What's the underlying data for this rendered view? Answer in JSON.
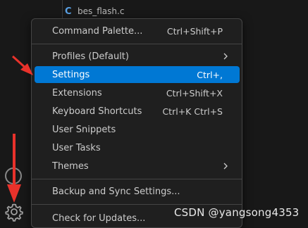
{
  "explorer": {
    "file_icon": "C",
    "file_name": "bes_flash.c"
  },
  "activity_bar": {
    "account_icon": "account-icon",
    "manage_icon": "gear-icon"
  },
  "menu": {
    "items": [
      {
        "label": "Command Palette...",
        "shortcut": "Ctrl+Shift+P"
      },
      {
        "label": "Profiles (Default)",
        "submenu": true
      },
      {
        "label": "Settings",
        "shortcut": "Ctrl+,",
        "active": true
      },
      {
        "label": "Extensions",
        "shortcut": "Ctrl+Shift+X"
      },
      {
        "label": "Keyboard Shortcuts",
        "shortcut": "Ctrl+K Ctrl+S"
      },
      {
        "label": "User Snippets"
      },
      {
        "label": "User Tasks"
      },
      {
        "label": "Themes",
        "submenu": true
      },
      {
        "label": "Backup and Sync Settings..."
      },
      {
        "label": "Check for Updates..."
      }
    ],
    "accent_color": "#0078d4"
  },
  "annotation": {
    "color": "#e8322b"
  },
  "watermark": "CSDN @yangsong4353"
}
